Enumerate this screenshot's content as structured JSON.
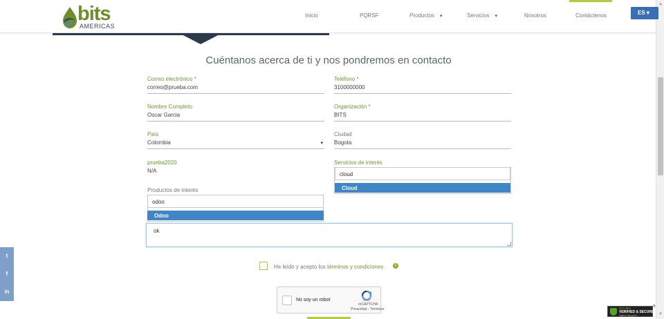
{
  "header": {
    "logo_word": "bits",
    "logo_sub": "AMERICAS",
    "nav": [
      {
        "label": "Inicio",
        "caret": false
      },
      {
        "label": "PQRSF",
        "caret": false
      },
      {
        "label": "Productos",
        "caret": true
      },
      {
        "label": "Servicios",
        "caret": true
      },
      {
        "label": "Nosotros",
        "caret": false
      },
      {
        "label": "Contáctenos",
        "caret": false
      }
    ],
    "caret_glyph": "▾",
    "lang": "ES ▾",
    "accent_color": "#b5cc3a",
    "lang_color": "#3a6fb6"
  },
  "form": {
    "title": "Cuéntanos acerca de ti y nos pondremos en contacto",
    "email_label": "Correo electrónico *",
    "email_value": "correo@prueba.com",
    "phone_label": "Teléfono *",
    "phone_value": "3100000000",
    "name_label": "Nombre Completo",
    "name_value": "Oscar Garcia",
    "org_label": "Organización *",
    "org_value": "BITS",
    "country_label": "País",
    "country_value": "Colombia",
    "city_label": "Ciudad",
    "city_value": "Bogota",
    "custom_label": "prueba2020",
    "custom_value": "N/A",
    "services_label": "Servicios de interés",
    "services_search": "cloud",
    "services_option": "Cloud",
    "products_label": "Productos de interés",
    "products_search": "odoo",
    "products_option": "Odoo",
    "message_value": "ok",
    "terms_prefix": "He leído y acepto los ",
    "terms_link": "términos y condiciones",
    "info_icon": "i"
  },
  "captcha": {
    "label": "No soy un robot",
    "brand": "reCAPTCHA",
    "legal": "Privacidad - Términos"
  },
  "social": [
    {
      "name": "twitter",
      "glyph": "t"
    },
    {
      "name": "facebook",
      "glyph": "f"
    },
    {
      "name": "linkedin",
      "glyph": "in"
    }
  ],
  "badge": {
    "top": "SECURED",
    "main": "VERIFIED & SECURED",
    "bottom": "VERIFY SECURITY",
    "reg": "®"
  }
}
